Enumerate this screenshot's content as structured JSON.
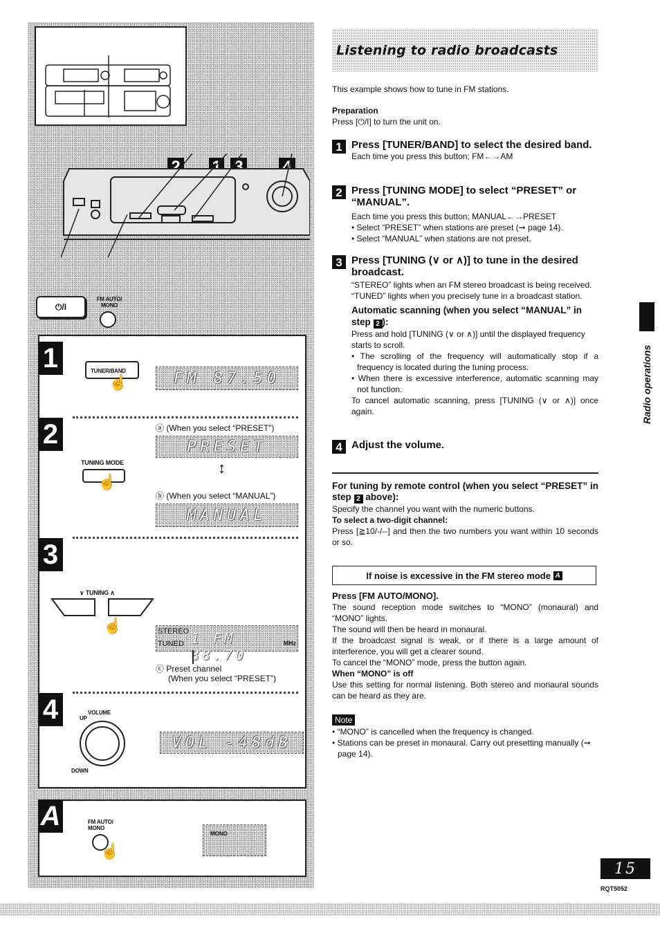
{
  "header": {
    "title": "Listening to radio broadcasts"
  },
  "intro": {
    "text": "This example shows how to tune in FM stations.",
    "preparation_label": "Preparation",
    "preparation_text": "Press [⏻/I] to turn the unit on."
  },
  "steps": [
    {
      "number": "1",
      "heading": "Press [TUNER/BAND] to select the desired band.",
      "lines": [
        "Each time you press this button;  FM←→AM"
      ]
    },
    {
      "number": "2",
      "heading": "Press [TUNING MODE] to select “PRESET” or “MANUAL”.",
      "lines": [
        "Each time you press this button;  MANUAL←→PRESET"
      ],
      "bullets": [
        "Select “PRESET” when stations are preset (➞ page 14).",
        "Select “MANUAL” when stations are not preset."
      ]
    },
    {
      "number": "3",
      "heading": "Press [TUNING (∨ or ∧)] to tune in the desired broadcast.",
      "lines": [
        "“STEREO” lights when an FM stereo broadcast is being received.",
        "“TUNED” lights when you precisely tune in a broadcast station."
      ],
      "auto_scan": {
        "heading": "Automatic scanning (when you select “MANUAL” in step",
        "step_ref": "2",
        "heading_end": "):",
        "text": "Press and hold [TUNING (∨ or ∧)] until the displayed frequency starts to scroll.",
        "bullets": [
          "The scrolling of the frequency will automatically stop if a frequency is located during the tuning process.",
          "When there is excessive interference, automatic scanning may not function."
        ],
        "cancel": "To cancel automatic scanning, press [TUNING (∨ or ∧)] once again."
      }
    },
    {
      "number": "4",
      "heading": "Adjust the volume."
    }
  ],
  "remote": {
    "heading": "For tuning by remote control (when you select “PRESET” in step",
    "step_ref": "2",
    "heading_end": "above):",
    "text": "Specify the channel you want with the numeric buttons.",
    "two_digit_label": "To select a two-digit channel:",
    "two_digit_text": "Press [≧10/-/--] and then the two numbers you want within 10 seconds or so."
  },
  "noise": {
    "box_title": "If noise is excessive in the FM stereo mode",
    "box_ref": "A",
    "press": "Press [FM AUTO/MONO].",
    "lines": [
      "The sound reception mode switches to “MONO” (monaural) and “MONO” lights.",
      "The sound will then be heard in monaural.",
      "If the broadcast signal is weak, or if there is a large amount of interference, you will get a clearer sound.",
      "To cancel the “MONO” mode, press the button again."
    ],
    "mono_off_label": "When “MONO” is off",
    "mono_off_text": "Use this setting for normal listening. Both stereo and monaural sounds can be heard as they are."
  },
  "note": {
    "label": "Note",
    "bullets": [
      "“MONO” is cancelled when the frequency is changed.",
      "Stations can be preset in monaural. Carry out presetting manually (➞ page 14)."
    ]
  },
  "sidebar": {
    "section_label": "Radio operations"
  },
  "footer": {
    "page_number": "15",
    "doc_code": "RQT5052"
  },
  "illustration": {
    "callouts": [
      "2",
      "1",
      "3",
      "4"
    ],
    "power_button_label": "⏻/I",
    "fm_auto_mono_label": "FM AUTO/ MONO",
    "step1": {
      "badge": "1",
      "button_label": "TUNER/BAND",
      "display": "FM  87.50"
    },
    "step2": {
      "badge": "2",
      "button_label": "TUNING MODE",
      "caption_a": "ⓐ (When you select “PRESET”)",
      "display_a": "PRESET",
      "caption_b": "ⓑ (When you select “MANUAL”)",
      "display_b": "MANUAL"
    },
    "step3": {
      "badge": "3",
      "button_label": "∨ TUNING ∧",
      "stereo": "STEREO",
      "tuned": "TUNED",
      "display": "1  FM  88.70",
      "unit": "MHz",
      "caption_c1": "ⓒ Preset channel",
      "caption_c2": "(When you select “PRESET”)"
    },
    "step4": {
      "badge": "4",
      "knob_label": "VOLUME",
      "up": "UP",
      "down": "DOWN",
      "display": "VOL  -48dB"
    },
    "stepA": {
      "badge": "A",
      "button_label": "FM AUTO/ MONO",
      "display": "MONO"
    }
  }
}
